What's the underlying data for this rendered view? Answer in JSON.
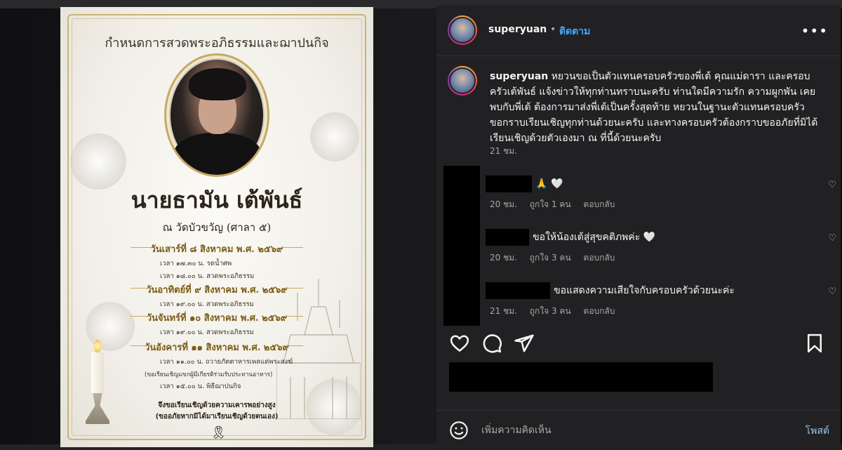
{
  "card": {
    "title": "กำหนดการสวดพระอภิธรรมและฌาปนกิจ",
    "name": "นายธามัน  เต้พันธ์",
    "venue": "ณ วัดบัวขวัญ (ศาลา ๕)",
    "schedule": [
      {
        "day": "วันเสาร์ที่ ๘ สิงหาคม พ.ศ. ๒๕๖๙",
        "lines": [
          "เวลา  ๑๗.๓๐  น.  รดน้ำศพ",
          "เวลา  ๑๘.๐๐  น.  สวดพระอภิธรรม"
        ]
      },
      {
        "day": "วันอาทิตย์ที่ ๙  สิงหาคม พ.ศ. ๒๕๖๙",
        "lines": [
          "เวลา  ๑๙.๐๐  น.  สวดพระอภิธรรม"
        ]
      },
      {
        "day": "วันจันทร์ที่ ๑๐ สิงหาคม พ.ศ. ๒๕๖๙",
        "lines": [
          "เวลา  ๑๙.๐๐  น.  สวดพระอภิธรรม"
        ]
      },
      {
        "day": "วันอังคารที่ ๑๑ สิงหาคม พ.ศ. ๒๕๖๙",
        "lines": [
          "เวลา  ๑๑.๐๐  น.  ถวายภัตตาหารเพลแด่พระสงฆ์",
          "(ขอเรียนเชิญแขกผู้มีเกียรติร่วมรับประทานอาหาร)",
          "เวลา  ๑๕.๐๐  น.  พิธีฌาปนกิจ"
        ]
      }
    ],
    "invite_line1": "จึงขอเรียนเชิญด้วยความเคารพอย่างสูง",
    "invite_line2": "(ขออภัยหากมิได้มาเรียนเชิญด้วยตนเอง)",
    "ribbon": "🎗"
  },
  "header": {
    "username": "superyuan",
    "dot": "•",
    "follow_label": "ติดตาม",
    "more": "•••"
  },
  "caption": {
    "username": "superyuan",
    "text": "หยวนขอเป็นตัวแทนครอบครัวของพี่เต้ คุณแม่ดารา และครอบครัวเต้พันธ์ แจ้งข่าวให้ทุกท่านทราบนะครับ ท่านใดมีความรัก ความผูกพัน เคยพบกับพี่เต้ ต้องการมาส่งพี่เต้เป็นครั้งสุดท้าย หยวนในฐานะตัวแทนครอบครัวขอกราบเรียนเชิญทุกท่านด้วยนะครับ และทางครอบครัวต้องกราบขออภัยที่มิได้เรียนเชิญด้วยตัวเองมา ณ ที่นี้ด้วยนะครับ",
    "time": "21 ชม."
  },
  "comments": [
    {
      "text": "🙏 🤍",
      "time": "20 ชม.",
      "likes": "ถูกใจ 1 คน",
      "reply": "ตอบกลับ"
    },
    {
      "text": "ขอให้น้องเต้สู่สุขคติภพค่ะ 🤍",
      "time": "20 ชม.",
      "likes": "ถูกใจ 3 คน",
      "reply": "ตอบกลับ"
    },
    {
      "text": "ขอแสดงความเสียใจกับครอบครัวด้วยนะค่ะ",
      "time": "21 ชม.",
      "likes": "ถูกใจ 3 คน",
      "reply": "ตอบกลับ"
    }
  ],
  "add_comment": {
    "placeholder": "เพิ่มความคิดเห็น",
    "post_label": "โพสต์"
  },
  "icons": [
    "like-icon",
    "comment-icon",
    "share-icon",
    "save-icon",
    "emoji-icon",
    "more-icon",
    "heart-icon"
  ],
  "colors": {
    "accent": "#4aa3f2",
    "panel": "#212123",
    "muted": "#a8a8a8"
  }
}
